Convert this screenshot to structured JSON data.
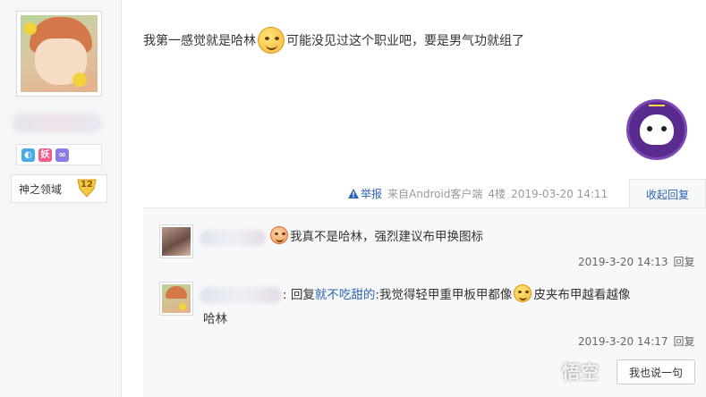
{
  "author": {
    "realm_label": "神之领域",
    "level": "12",
    "badges": [
      {
        "icon": "droplet-badge-icon",
        "glyph": "◐",
        "color": "#4aa9e8"
      },
      {
        "icon": "demon-badge-icon",
        "glyph": "妖",
        "color": "#f15d8f"
      },
      {
        "icon": "chain-badge-icon",
        "glyph": "∞",
        "color": "#8b7be6"
      }
    ]
  },
  "post": {
    "text_before_emoji": "我第一感觉就是哈林",
    "text_after_emoji": "可能没见过这个职业吧，要是男气功就组了",
    "report_label": "举报",
    "source": "来自Android客户端",
    "floor": "4楼",
    "timestamp": "2019-03-20 14:11",
    "fold_label": "收起回复"
  },
  "replies": [
    {
      "text": "我真不是哈林，强烈建议布甲换图标",
      "time": "2019-3-20 14:13",
      "reply_label": "回复"
    },
    {
      "prefix": ": 回复 ",
      "target_user": "就不吃甜的",
      "text_before_emoji": " :我觉得轻甲重甲板甲都像",
      "text_after_emoji": "皮夹布甲越看越像",
      "text_wrap": "哈林",
      "time": "2019-3-20 14:17",
      "reply_label": "回复"
    }
  ],
  "floating": {
    "button_label": "我也说一句",
    "watermark": "悟空"
  }
}
